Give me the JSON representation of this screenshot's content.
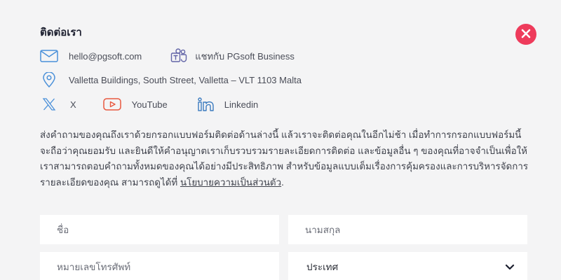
{
  "header": {
    "title": "ติดต่อเรา"
  },
  "contacts": {
    "email": "hello@pgsoft.com",
    "teams": "แชทกับ PGsoft Business",
    "address": "Valletta Buildings, South Street, Valletta – VLT 1103 Malta",
    "x": "X",
    "youtube": "YouTube",
    "linkedin": "Linkedin"
  },
  "intro": {
    "text": "ส่งคำถามของคุณถึงเราด้วยกรอกแบบฟอร์มติดต่อด้านล่างนี้ แล้วเราจะติดต่อคุณในอีกไม่ช้า เมื่อทำการกรอกแบบฟอร์มนี้ จะถือว่าคุณยอมรับ และยินดีให้คำอนุญาตเราเก็บรวบรวมรายละเอียดการติดต่อ และข้อมูลอื่น ๆ ของคุณที่อาจจำเป็นเพื่อให้เราสามารถตอบคำถามทั้งหมดของคุณได้อย่างมีประสิทธิภาพ สำหรับข้อมูลแบบเต็มเรื่องการคุ้มครองและการบริหารจัดการรายละเอียดของคุณ สามารถดูได้ที่ ",
    "link": "นโยบายความเป็นส่วนตัว",
    "end": "."
  },
  "form": {
    "first_name_placeholder": "ชื่อ",
    "last_name_placeholder": "นามสกุล",
    "phone_placeholder": "หมายเลขโทรศัพท์",
    "country_value": "ประเทศ"
  },
  "colors": {
    "accent": "#ee3b5b",
    "icon_blue": "#4a90d9",
    "icon_purple": "#6264a7",
    "icon_red": "#e8583f",
    "icon_linkedin": "#3b7bbf",
    "background": "#f4f4f5",
    "field": "#ffffff"
  }
}
